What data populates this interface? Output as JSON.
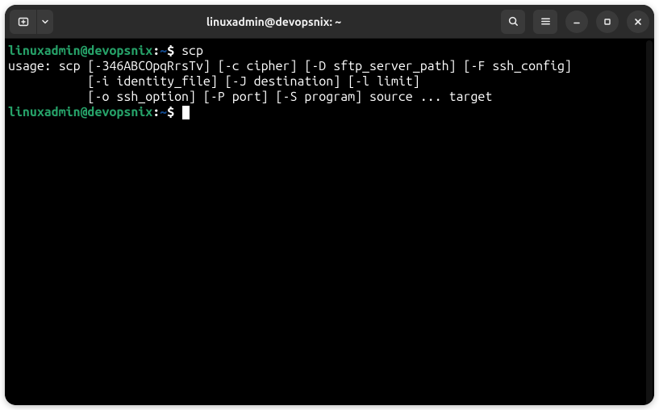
{
  "titlebar": {
    "title": "linuxadmin@devopsnix: ~"
  },
  "prompt": {
    "user_host": "linuxadmin@devopsnix",
    "sep": ":",
    "path": "~",
    "symbol": "$"
  },
  "session": {
    "cmd1": "scp",
    "usage_l1": "usage: scp [-346ABCOpqRrsTv] [-c cipher] [-D sftp_server_path] [-F ssh_config]",
    "usage_l2": "           [-i identity_file] [-J destination] [-l limit]",
    "usage_l3": "           [-o ssh_option] [-P port] [-S program] source ... target"
  },
  "icons": {
    "newtab": "new-tab-icon",
    "dropdown": "chevron-down-icon",
    "search": "search-icon",
    "menu": "hamburger-menu-icon",
    "minimize": "minimize-icon",
    "maximize": "maximize-icon",
    "close": "close-icon"
  }
}
